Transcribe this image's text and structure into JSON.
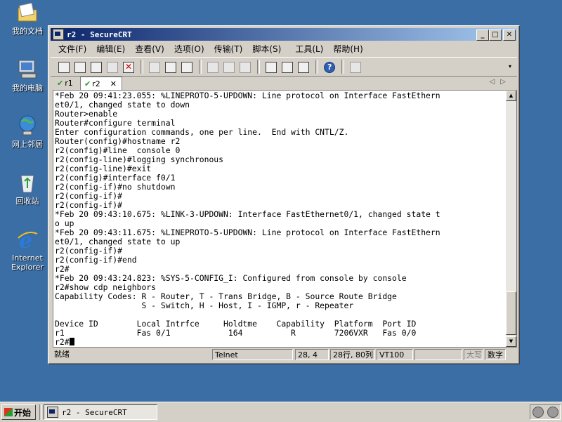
{
  "desktop": {
    "icons": [
      {
        "label": "我的文档",
        "icon": "folder-icon"
      },
      {
        "label": "我的电脑",
        "icon": "computer-icon"
      },
      {
        "label": "网上邻居",
        "icon": "network-icon"
      },
      {
        "label": "回收站",
        "icon": "recycle-bin-icon"
      },
      {
        "label": "Internet Explorer",
        "icon": "internet-explorer-icon"
      }
    ]
  },
  "window": {
    "title": "r2 - SecureCRT",
    "controls": {
      "minimize": "_",
      "maximize": "□",
      "close": "✕"
    }
  },
  "menu": {
    "items": [
      "文件(F)",
      "编辑(E)",
      "查看(V)",
      "选项(O)",
      "传输(T)",
      "脚本(S)",
      "工具(L)",
      "帮助(H)"
    ]
  },
  "tabs": [
    {
      "label": "r1",
      "active": false
    },
    {
      "label": "r2",
      "active": true,
      "close": "✕"
    }
  ],
  "terminal": {
    "lines": [
      "*Feb 20 09:41:23.055: %LINEPROTO-5-UPDOWN: Line protocol on Interface FastEthern",
      "et0/1, changed state to down",
      "Router>enable",
      "Router#configure terminal",
      "Enter configuration commands, one per line.  End with CNTL/Z.",
      "Router(config)#hostname r2",
      "r2(config)#line  console 0",
      "r2(config-line)#logging synchronous",
      "r2(config-line)#exit",
      "r2(config)#interface f0/1",
      "r2(config-if)#no shutdown",
      "r2(config-if)#",
      "r2(config-if)#",
      "*Feb 20 09:43:10.675: %LINK-3-UPDOWN: Interface FastEthernet0/1, changed state t",
      "o up",
      "*Feb 20 09:43:11.675: %LINEPROTO-5-UPDOWN: Line protocol on Interface FastEthern",
      "et0/1, changed state to up",
      "r2(config-if)#",
      "r2(config-if)#end",
      "r2#",
      "*Feb 20 09:43:24.823: %SYS-5-CONFIG_I: Configured from console by console",
      "r2#show cdp neighbors",
      "Capability Codes: R - Router, T - Trans Bridge, B - Source Route Bridge",
      "                  S - Switch, H - Host, I - IGMP, r - Repeater",
      "",
      "Device ID        Local Intrfce     Holdtme    Capability  Platform  Port ID",
      "r1               Fas 0/1            164          R        7206VXR   Fas 0/0"
    ],
    "prompt": "r2#"
  },
  "status": {
    "ready": "就绪",
    "protocol": "Telnet",
    "cursor_pos": "28,  4",
    "size": "28行, 80列",
    "emulation": "VT100",
    "caps": "大写",
    "num": "数字"
  },
  "taskbar": {
    "start_label": "开始",
    "task_label": "r2 - SecureCRT"
  }
}
